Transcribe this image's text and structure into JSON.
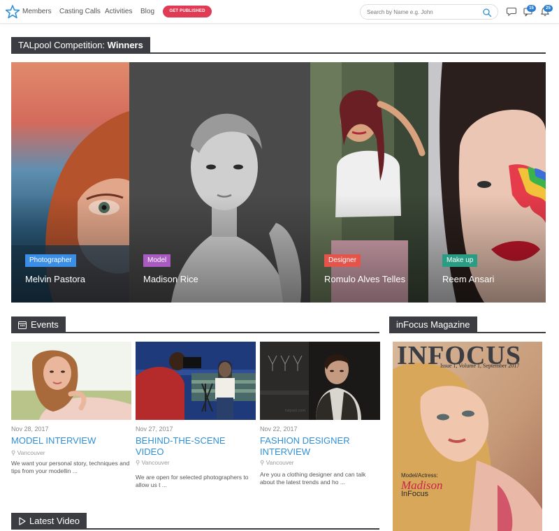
{
  "nav": {
    "links": [
      "Members",
      "Casting Calls",
      "Activities",
      "Blog"
    ],
    "publish_label": "GET PUBLISHED",
    "search_placeholder": "Search by Name e.g. John",
    "notifications": {
      "messages_count": "15",
      "alerts_count": "25"
    }
  },
  "winners_section": {
    "title_prefix": "TALpool Competition:",
    "title_bold": "Winners",
    "items": [
      {
        "role": "Photographer",
        "name": "Melvin Pastora",
        "role_color": "#3a8ee6"
      },
      {
        "role": "Model",
        "name": "Madison Rice",
        "role_color": "#a95bc2"
      },
      {
        "role": "Designer",
        "name": "Romulo Alves Telles",
        "role_color": "#e4544a"
      },
      {
        "role": "Make up",
        "name": "Reem Ansari",
        "role_color": "#2b9c84"
      }
    ]
  },
  "events_section": {
    "title": "Events",
    "items": [
      {
        "date": "Nov 28, 2017",
        "title": "MODEL INTERVIEW",
        "location": "Vancouver",
        "description": "We want your personal story, techniques and tips from your modellin ..."
      },
      {
        "date": "Nov 27, 2017",
        "title": "BEHIND-THE-SCENE VIDEO",
        "location": "Vancouver",
        "description": "We are open for selected photographers to allow us t ..."
      },
      {
        "date": "Nov 22, 2017",
        "title": "FASHION DESIGNER INTERVIEW",
        "location": "Vancouver",
        "description": "Are you a clothing designer and can talk about the latest trends and ho ..."
      }
    ]
  },
  "magazine_section": {
    "title": "inFocus Magazine",
    "cover": {
      "masthead": "INFOCUS",
      "issue": "Issue 1, Volume 1, September 2017",
      "caption": "Model/Actress:",
      "signature": "Madison",
      "brand": "InFocus"
    }
  },
  "video_section": {
    "title": "Latest Video"
  },
  "colors": {
    "accent_blue": "#2f8fd6",
    "publish_red": "#e13a55",
    "header_dark": "#3b3d42"
  }
}
